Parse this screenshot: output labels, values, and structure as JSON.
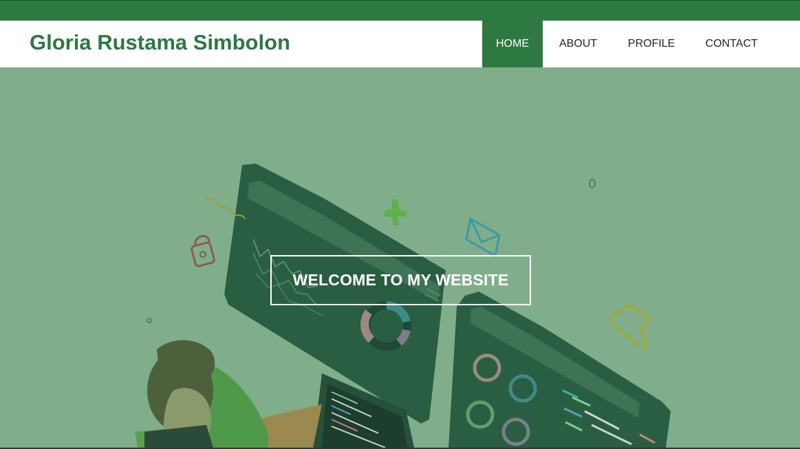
{
  "header": {
    "site_title": "Gloria Rustama Simbolon"
  },
  "nav": {
    "items": [
      {
        "label": "HOME",
        "active": true
      },
      {
        "label": "ABOUT",
        "active": false
      },
      {
        "label": "PROFILE",
        "active": false
      },
      {
        "label": "CONTACT",
        "active": false
      }
    ]
  },
  "hero": {
    "welcome_text": "WELCOME TO MY WEBSITE",
    "illustration": "developer-dashboard-illustration"
  },
  "colors": {
    "brand_green": "#2e7841",
    "hero_background": "#80ae8b",
    "header_background": "#ffffff"
  }
}
